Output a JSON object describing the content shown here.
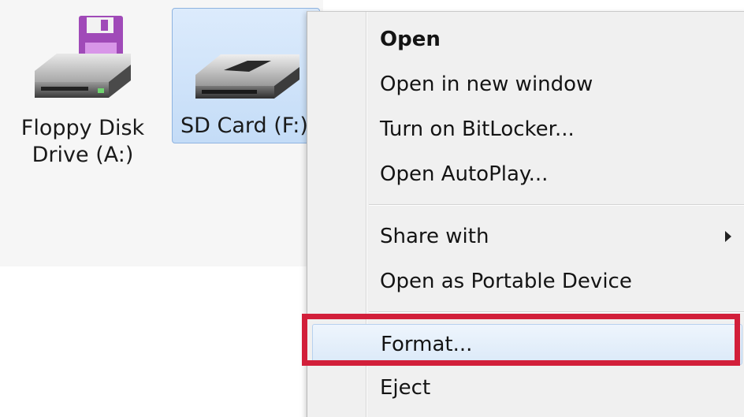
{
  "desktop": {
    "drives": [
      {
        "name": "Floppy Disk Drive (A:)",
        "label_line1": "Floppy Disk",
        "label_line2": "Drive (A:)",
        "icon": "floppy-drive-icon",
        "selected": false
      },
      {
        "name": "SD Card (F:)",
        "label_line1": "SD Card (F:)",
        "icon": "sd-card-drive-icon",
        "selected": true
      }
    ]
  },
  "context_menu": {
    "items": [
      {
        "label": "Open",
        "bold": true
      },
      {
        "label": "Open in new window"
      },
      {
        "label": "Turn on BitLocker..."
      },
      {
        "label": "Open AutoPlay..."
      },
      {
        "label": "Share with",
        "submenu": true,
        "icon": "chevron-right-icon"
      },
      {
        "label": "Open as Portable Device"
      },
      {
        "label": "Format...",
        "highlighted": true
      },
      {
        "label": "Eject"
      }
    ]
  },
  "colors": {
    "selection_fill": "#c4dcf7",
    "selection_border": "#8fb4e0",
    "menu_background": "#f0f0f0",
    "annotation_red": "#d21f3a",
    "floppy_purple": "#a04ab8"
  },
  "annotation": {
    "type": "highlight-rectangle",
    "target": "Format..."
  }
}
